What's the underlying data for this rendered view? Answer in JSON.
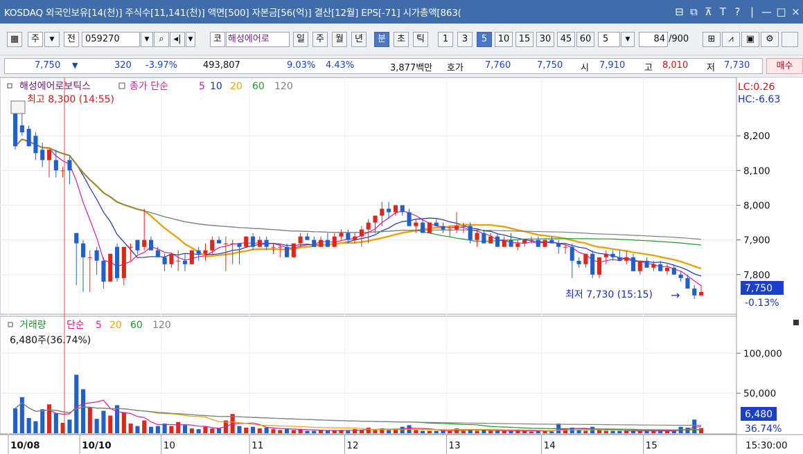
{
  "window": {
    "title": "KOSDAQ 외국인보유[14(천)] 주식수[11,141(천)] 액면[500] 자본금[56(억)] 결산[12월] EPS[-71] 시가총액[863(",
    "controls": [
      "⊟",
      "⧉",
      "⊼",
      "T",
      "?",
      "|",
      "—",
      "□",
      "×"
    ]
  },
  "toolbar": {
    "market": "주",
    "period_prefix": "전",
    "code": "059270",
    "corp_prefix": "코",
    "company": "해성에어로",
    "periods": [
      "일",
      "주",
      "월",
      "년",
      "분",
      "초",
      "틱"
    ],
    "active_period": "분",
    "minutes": [
      "1",
      "3",
      "5",
      "10",
      "15",
      "30",
      "45",
      "60"
    ],
    "active_minute": "5",
    "interval_value": "5",
    "count_value": "84",
    "count_total": "/900"
  },
  "quote": {
    "price": "7,750",
    "change": "320",
    "change_pct": "-3.97%",
    "volume": "493,807",
    "turnover_pct": "9.03%",
    "foreign_pct": "4.43%",
    "amount": "3,877백만",
    "bid_label": "호가",
    "bid": "7,760",
    "ask": "7,750",
    "open_label": "시",
    "open": "7,910",
    "high_label": "고",
    "high": "8,010",
    "low_label": "저",
    "low": "7,730",
    "trade_button": "매수"
  },
  "price_panel": {
    "legend_name": "해성에어로보틱스",
    "legend_kind": "종가 단순",
    "ma_labels": [
      "5",
      "10",
      "20",
      "60",
      "120"
    ],
    "max_label": "최고 8,300 (14:55)",
    "min_label": "최저 7,730 (15:15)",
    "lc_label": "LC:0.26",
    "hc_label": "HC:-6.63",
    "price_tag": "7,750",
    "price_tag_pct": "-0.13%"
  },
  "volume_panel": {
    "legend_name": "거래량",
    "legend_kind": "단순",
    "ma_labels": [
      "5",
      "20",
      "60",
      "120"
    ],
    "last_label": "6,480주(36.74%)",
    "tag_value": "6,480",
    "tag_pct": "36.74%"
  },
  "colors": {
    "up": "#e0251b",
    "down": "#1f5fd0",
    "ma5": "#e0199e",
    "ma10": "#1a2fb8",
    "ma20": "#e8a30a",
    "ma60": "#1a9a2a",
    "ma120": "#808080"
  },
  "chart_data": {
    "type": "candlestick",
    "price_axis": {
      "ticks": [
        8200,
        8100,
        8000,
        7900,
        7800
      ],
      "range": [
        7690,
        8360
      ]
    },
    "volume_axis": {
      "ticks": [
        100000,
        50000
      ],
      "range": [
        0,
        140000
      ]
    },
    "x_labels": [
      "10/08",
      "10/10",
      "10",
      "11",
      "12",
      "13",
      "14",
      "15"
    ],
    "time_label": "15:30:00",
    "candles": [
      [
        8300,
        8300,
        8160,
        8170,
        31000
      ],
      [
        8230,
        8290,
        8200,
        8210,
        45000
      ],
      [
        8220,
        8230,
        8170,
        8170,
        19000
      ],
      [
        8200,
        8210,
        8130,
        8150,
        15000
      ],
      [
        8160,
        8180,
        8110,
        8130,
        30000
      ],
      [
        8130,
        8160,
        8080,
        8160,
        36000
      ],
      [
        8130,
        8160,
        8080,
        8100,
        25000
      ],
      [
        8100,
        8110,
        8080,
        8100,
        13000
      ],
      [
        8130,
        8140,
        8060,
        8100,
        17000
      ],
      [
        7920,
        7920,
        7770,
        7890,
        73000
      ],
      [
        7890,
        7900,
        7750,
        7850,
        55000
      ],
      [
        7850,
        7870,
        7750,
        7850,
        32000
      ],
      [
        7870,
        7880,
        7800,
        7840,
        18000
      ],
      [
        7840,
        7850,
        7760,
        7780,
        28000
      ],
      [
        7780,
        7860,
        7780,
        7860,
        22000
      ],
      [
        7880,
        7890,
        7780,
        7790,
        35000
      ],
      [
        7790,
        7880,
        7770,
        7880,
        26000
      ],
      [
        7880,
        7890,
        7840,
        7880,
        12000
      ],
      [
        7900,
        7900,
        7860,
        7870,
        9000
      ],
      [
        7880,
        7990,
        7870,
        7900,
        16000
      ],
      [
        7900,
        7910,
        7870,
        7870,
        8000
      ],
      [
        7870,
        7880,
        7850,
        7850,
        9000
      ],
      [
        7850,
        7860,
        7810,
        7830,
        12000
      ],
      [
        7830,
        7860,
        7820,
        7860,
        9000
      ],
      [
        7840,
        7870,
        7810,
        7840,
        14000
      ],
      [
        7840,
        7860,
        7810,
        7830,
        10000
      ],
      [
        7830,
        7870,
        7830,
        7870,
        6000
      ],
      [
        7870,
        7880,
        7840,
        7860,
        5000
      ],
      [
        7860,
        7890,
        7840,
        7870,
        8000
      ],
      [
        7870,
        7910,
        7860,
        7900,
        6000
      ],
      [
        7900,
        7910,
        7890,
        7890,
        6000
      ],
      [
        7890,
        7910,
        7810,
        7890,
        16000
      ],
      [
        7890,
        7900,
        7830,
        7890,
        24000
      ],
      [
        7890,
        7890,
        7830,
        7880,
        9000
      ],
      [
        7880,
        7910,
        7880,
        7910,
        7000
      ],
      [
        7910,
        7920,
        7870,
        7880,
        8000
      ],
      [
        7880,
        7910,
        7880,
        7900,
        6000
      ],
      [
        7900,
        7910,
        7870,
        7880,
        7000
      ],
      [
        7880,
        7890,
        7860,
        7880,
        5000
      ],
      [
        7880,
        7890,
        7850,
        7880,
        4000
      ],
      [
        7880,
        7890,
        7850,
        7850,
        6000
      ],
      [
        7850,
        7890,
        7850,
        7890,
        4000
      ],
      [
        7890,
        7920,
        7880,
        7910,
        5000
      ],
      [
        7910,
        7920,
        7900,
        7900,
        3000
      ],
      [
        7900,
        7910,
        7880,
        7880,
        3000
      ],
      [
        7880,
        7910,
        7880,
        7900,
        4000
      ],
      [
        7900,
        7920,
        7880,
        7880,
        3000
      ],
      [
        7880,
        7920,
        7880,
        7910,
        4000
      ],
      [
        7910,
        7930,
        7900,
        7920,
        4000
      ],
      [
        7920,
        7930,
        7890,
        7900,
        3000
      ],
      [
        7900,
        7920,
        7890,
        7910,
        5000
      ],
      [
        7910,
        7940,
        7880,
        7930,
        4000
      ],
      [
        7930,
        7960,
        7890,
        7950,
        7000
      ],
      [
        7950,
        7970,
        7920,
        7970,
        4000
      ],
      [
        7970,
        8010,
        7940,
        7990,
        6000
      ],
      [
        7990,
        8010,
        7960,
        7980,
        4000
      ],
      [
        7980,
        8000,
        7970,
        8000,
        5000
      ],
      [
        8000,
        8000,
        7970,
        7980,
        8000
      ],
      [
        7980,
        7990,
        7940,
        7940,
        10000
      ],
      [
        7940,
        7960,
        7920,
        7950,
        4000
      ],
      [
        7950,
        7960,
        7920,
        7920,
        3000
      ],
      [
        7920,
        7950,
        7920,
        7950,
        3000
      ],
      [
        7950,
        7960,
        7940,
        7940,
        3000
      ],
      [
        7940,
        7950,
        7920,
        7930,
        4000
      ],
      [
        7930,
        7940,
        7910,
        7930,
        3000
      ],
      [
        7930,
        7980,
        7920,
        7940,
        6000
      ],
      [
        7940,
        7950,
        7920,
        7940,
        3000
      ],
      [
        7940,
        7950,
        7890,
        7900,
        5000
      ],
      [
        7900,
        7930,
        7880,
        7920,
        3000
      ],
      [
        7920,
        7930,
        7890,
        7890,
        4000
      ],
      [
        7890,
        7920,
        7890,
        7910,
        3000
      ],
      [
        7910,
        7920,
        7880,
        7880,
        3000
      ],
      [
        7880,
        7910,
        7880,
        7900,
        3000
      ],
      [
        7900,
        7920,
        7890,
        7880,
        3000
      ],
      [
        7880,
        7900,
        7870,
        7890,
        4000
      ],
      [
        7890,
        7900,
        7880,
        7900,
        3000
      ],
      [
        7900,
        7910,
        7890,
        7900,
        2000
      ],
      [
        7900,
        7910,
        7880,
        7880,
        3000
      ],
      [
        7880,
        7900,
        7880,
        7900,
        3000
      ],
      [
        7900,
        7910,
        7890,
        7890,
        2000
      ],
      [
        7890,
        7900,
        7860,
        7880,
        12000
      ],
      [
        7880,
        7890,
        7860,
        7880,
        5000
      ],
      [
        7880,
        7890,
        7790,
        7840,
        7000
      ],
      [
        7840,
        7850,
        7820,
        7830,
        4000
      ],
      [
        7830,
        7860,
        7820,
        7860,
        3000
      ],
      [
        7860,
        7870,
        7790,
        7800,
        8000
      ],
      [
        7800,
        7850,
        7790,
        7850,
        4000
      ],
      [
        7850,
        7870,
        7830,
        7860,
        3000
      ],
      [
        7860,
        7870,
        7840,
        7850,
        3000
      ],
      [
        7850,
        7870,
        7840,
        7840,
        3000
      ],
      [
        7840,
        7870,
        7830,
        7850,
        3000
      ],
      [
        7850,
        7860,
        7810,
        7810,
        4000
      ],
      [
        7810,
        7840,
        7800,
        7840,
        3000
      ],
      [
        7840,
        7850,
        7820,
        7820,
        3000
      ],
      [
        7820,
        7840,
        7810,
        7830,
        3000
      ],
      [
        7830,
        7840,
        7810,
        7810,
        3000
      ],
      [
        7810,
        7830,
        7800,
        7820,
        3000
      ],
      [
        7820,
        7830,
        7800,
        7800,
        3000
      ],
      [
        7800,
        7810,
        7780,
        7790,
        8000
      ],
      [
        7790,
        7800,
        7760,
        7760,
        7000
      ],
      [
        7760,
        7770,
        7730,
        7740,
        17000
      ],
      [
        7740,
        7770,
        7740,
        7750,
        6480
      ]
    ]
  }
}
